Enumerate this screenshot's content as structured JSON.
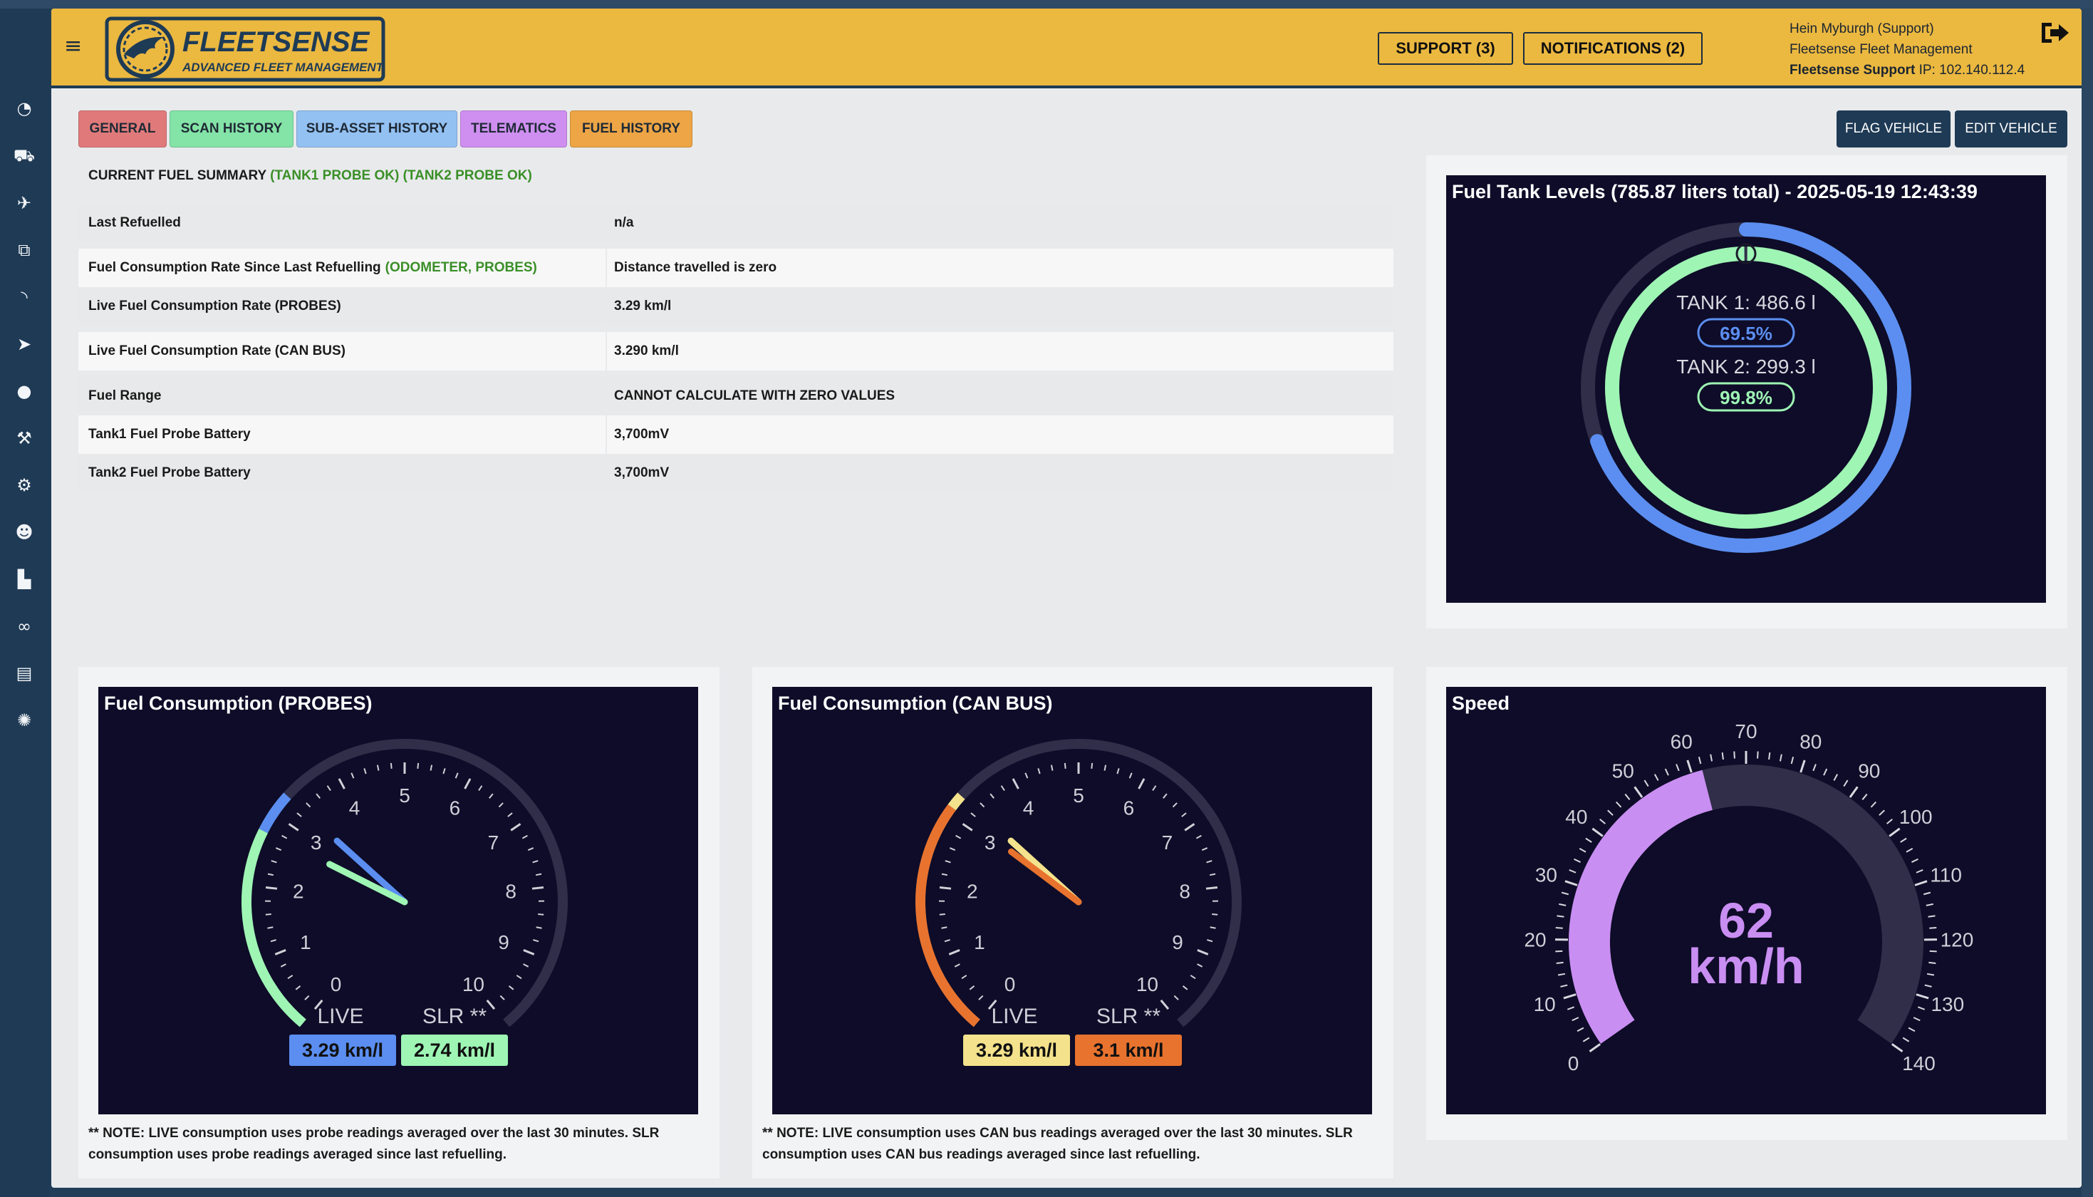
{
  "header": {
    "logo_text": "FLEETSENSE",
    "logo_subtitle": "ADVANCED FLEET MANAGEMENT",
    "support_label": "SUPPORT (3)",
    "notifications_label": "NOTIFICATIONS (2)",
    "user_name": "Hein Myburgh (Support)",
    "company": "Fleetsense Fleet Management",
    "support_bold": "Fleetsense Support",
    "ip_text": "IP: 102.140.112.4"
  },
  "sidebar": {
    "items": [
      {
        "name": "dashboard-icon",
        "glyph": "◔"
      },
      {
        "name": "truck-icon",
        "glyph": "⛟"
      },
      {
        "name": "satellite-icon",
        "glyph": "✈"
      },
      {
        "name": "tags-icon",
        "glyph": "⧉"
      },
      {
        "name": "rss-icon",
        "glyph": "◝"
      },
      {
        "name": "location-arrow-icon",
        "glyph": "➤"
      },
      {
        "name": "fuel-drop-icon",
        "glyph": "●"
      },
      {
        "name": "wrench-icon",
        "glyph": "⚒"
      },
      {
        "name": "tires-icon",
        "glyph": "⚙"
      },
      {
        "name": "user-icon",
        "glyph": "☻"
      },
      {
        "name": "industry-icon",
        "glyph": "▙"
      },
      {
        "name": "link-icon",
        "glyph": "∞"
      },
      {
        "name": "book-icon",
        "glyph": "▤"
      },
      {
        "name": "settings-gear-icon",
        "glyph": "✺"
      }
    ]
  },
  "tabs": [
    {
      "label": "GENERAL",
      "color": "#e07a7a"
    },
    {
      "label": "SCAN HISTORY",
      "color": "#84e3a7"
    },
    {
      "label": "SUB-ASSET HISTORY",
      "color": "#93c1f2"
    },
    {
      "label": "TELEMATICS",
      "color": "#cf8ff0"
    },
    {
      "label": "FUEL HISTORY",
      "color": "#eda545"
    }
  ],
  "actions": {
    "flag_label": "FLAG VEHICLE",
    "edit_label": "EDIT VEHICLE"
  },
  "summary": {
    "title": "CURRENT FUEL SUMMARY",
    "title_status": "(TANK1 PROBE OK) (TANK2 PROBE OK)",
    "rows": [
      {
        "label": "Last Refuelled",
        "label_extra": "",
        "value": "n/a",
        "value_green": false
      },
      {
        "label": "Fuel Consumption Rate Since Last Refuelling",
        "label_extra": "(ODOMETER, PROBES)",
        "value": "Distance travelled is zero",
        "value_green": true
      },
      {
        "label": "Live Fuel Consumption Rate (PROBES)",
        "label_extra": "",
        "value": "3.29 km/l",
        "value_green": false
      },
      {
        "label": "Live Fuel Consumption Rate (CAN BUS)",
        "label_extra": "",
        "value": "3.290 km/l",
        "value_green": false
      },
      {
        "label": "Fuel Range",
        "label_extra": "",
        "value": "CANNOT CALCULATE WITH ZERO VALUES",
        "value_green": true
      },
      {
        "label": "Tank1 Fuel Probe Battery",
        "label_extra": "",
        "value": "3,700mV",
        "value_green": true
      },
      {
        "label": "Tank2 Fuel Probe Battery",
        "label_extra": "",
        "value": "3,700mV",
        "value_green": true
      }
    ]
  },
  "tank_chart": {
    "title": "Fuel Tank Levels (785.87 liters total) - 2025-05-19 12:43:39",
    "tank1_label": "TANK 1: 486.6 l",
    "tank1_pct_label": "69.5%",
    "tank1_pct": 0.695,
    "tank2_label": "TANK 2: 299.3 l",
    "tank2_pct_label": "99.8%",
    "tank2_pct": 0.998,
    "tank1_color": "#5b8ef0",
    "tank2_color": "#9ef5b4"
  },
  "probes_chart": {
    "title": "Fuel Consumption (PROBES)",
    "ticks": [
      "0",
      "1",
      "2",
      "3",
      "4",
      "5",
      "6",
      "7",
      "8",
      "9",
      "10"
    ],
    "live_label": "LIVE",
    "slr_label": "SLR **",
    "live_value": 3.29,
    "slr_value": 2.74,
    "live_text": "3.29 km/l",
    "slr_text": "2.74 km/l",
    "live_color": "#5b8ef0",
    "slr_color": "#9ef5b4",
    "note": "** NOTE: LIVE consumption uses probe readings averaged over the last 30 minutes. SLR consumption uses probe readings averaged since last refuelling."
  },
  "canbus_chart": {
    "title": "Fuel Consumption (CAN BUS)",
    "ticks": [
      "0",
      "1",
      "2",
      "3",
      "4",
      "5",
      "6",
      "7",
      "8",
      "9",
      "10"
    ],
    "live_label": "LIVE",
    "slr_label": "SLR **",
    "live_value": 3.29,
    "slr_value": 3.1,
    "live_text": "3.29 km/l",
    "slr_text": "3.1 km/l",
    "live_color": "#f4e28c",
    "slr_color": "#e8732f",
    "note": "** NOTE: LIVE consumption uses CAN bus readings averaged over the last 30 minutes. SLR consumption uses CAN bus readings averaged since last refuelling."
  },
  "speed_chart": {
    "title": "Speed",
    "ticks": [
      "0",
      "10",
      "20",
      "30",
      "40",
      "50",
      "60",
      "70",
      "80",
      "90",
      "100",
      "110",
      "120",
      "130",
      "140"
    ],
    "value": 62,
    "value_text": "62",
    "unit": "km/h",
    "max": 140,
    "color": "#c98ef2"
  }
}
